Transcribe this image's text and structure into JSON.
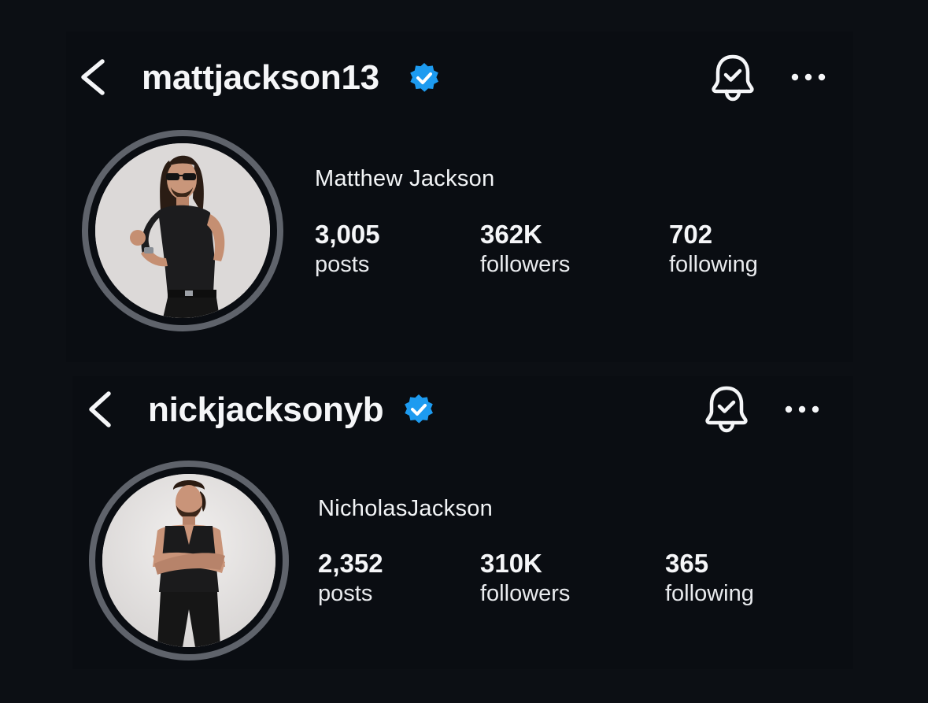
{
  "profiles": [
    {
      "username": "mattjackson13",
      "full_name": "Matthew Jackson",
      "verified": true,
      "stats": [
        {
          "value": "3,005",
          "label": "posts"
        },
        {
          "value": "362K",
          "label": "followers"
        },
        {
          "value": "702",
          "label": "following"
        }
      ]
    },
    {
      "username": "nickjacksonyb",
      "full_name": "NicholasJackson",
      "verified": true,
      "stats": [
        {
          "value": "2,352",
          "label": "posts"
        },
        {
          "value": "310K",
          "label": "followers"
        },
        {
          "value": "365",
          "label": "following"
        }
      ]
    }
  ],
  "icons": {
    "back": "chevron-left-icon",
    "verified": "verified-badge-icon",
    "notifications": "bell-check-icon",
    "more": "more-horizontal-icon"
  },
  "colors": {
    "background": "#0c0f14",
    "verified_badge": "#1d9bf0",
    "avatar_ring": "#5f636b",
    "text": "#f5f6f8"
  }
}
